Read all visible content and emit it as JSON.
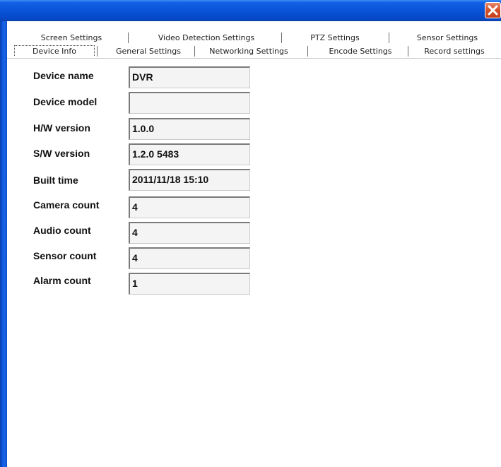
{
  "window": {
    "close_label": "×"
  },
  "tabs": {
    "back_row": [
      "Screen Settings",
      "Video Detection Settings",
      "PTZ Settings",
      "Sensor Settings"
    ],
    "front_row": [
      "Device Info",
      "General Settings",
      "Networking Settings",
      "Encode Settings",
      "Record settings"
    ],
    "active": "Device Info"
  },
  "device_info": {
    "fields": [
      {
        "label": "Device name",
        "value": "DVR"
      },
      {
        "label": "Device model",
        "value": ""
      },
      {
        "label": "H/W version",
        "value": "1.0.0"
      },
      {
        "label": "S/W version",
        "value": "1.2.0 5483"
      },
      {
        "label": "Built time",
        "value": "2011/11/18 15:10"
      },
      {
        "label": "Camera count",
        "value": "4"
      },
      {
        "label": "Audio count",
        "value": "4"
      },
      {
        "label": "Sensor count",
        "value": "4"
      },
      {
        "label": "Alarm count",
        "value": "1"
      }
    ]
  },
  "colors": {
    "titlebar": "#0a54d8",
    "close_button": "#d5552f",
    "field_background": "#f4f4f4"
  }
}
